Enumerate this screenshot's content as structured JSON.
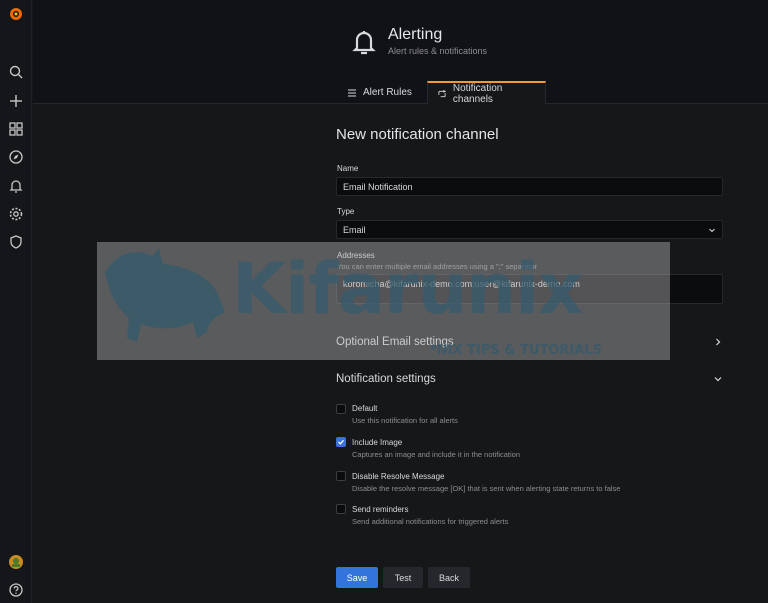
{
  "header": {
    "title": "Alerting",
    "subtitle": "Alert rules & notifications"
  },
  "tabs": [
    {
      "label": "Alert Rules",
      "icon": "list-icon",
      "active": false
    },
    {
      "label": "Notification channels",
      "icon": "comment-alt-share-icon",
      "active": true
    }
  ],
  "page_title": "New notification channel",
  "form": {
    "name_label": "Name",
    "name_value": "Email Notification",
    "type_label": "Type",
    "type_value": "Email",
    "addresses_label": "Addresses",
    "addresses_help": "You can enter multiple email addresses using a \";\" separator",
    "addresses_value": "koromicha@kifarunix-demo.com;user@kifarunix-demo.com"
  },
  "sections": {
    "optional_email": "Optional Email settings",
    "notification": "Notification settings"
  },
  "options": [
    {
      "title": "Default",
      "desc": "Use this notification for all alerts",
      "checked": false
    },
    {
      "title": "Include Image",
      "desc": "Captures an image and include it in the notification",
      "checked": true
    },
    {
      "title": "Disable Resolve Message",
      "desc": "Disable the resolve message [OK] that is sent when alerting state returns to false",
      "checked": false
    },
    {
      "title": "Send reminders",
      "desc": "Send additional notifications for triggered alerts",
      "checked": false
    }
  ],
  "buttons": {
    "save": "Save",
    "test": "Test",
    "back": "Back"
  },
  "watermark": {
    "text": "Kifarunix",
    "subtitle": "*NIX TIPS & TUTORIALS"
  },
  "colors": {
    "accent_tab": "#f59a2b",
    "primary": "#3274d9",
    "checkbox_checked": "#3d71d9"
  },
  "sidebar_icons": [
    "grafana-logo-icon",
    "search-icon",
    "plus-icon",
    "dashboards-icon",
    "explore-icon",
    "bell-icon",
    "gear-icon",
    "shield-icon",
    "user-avatar-icon",
    "help-icon"
  ]
}
